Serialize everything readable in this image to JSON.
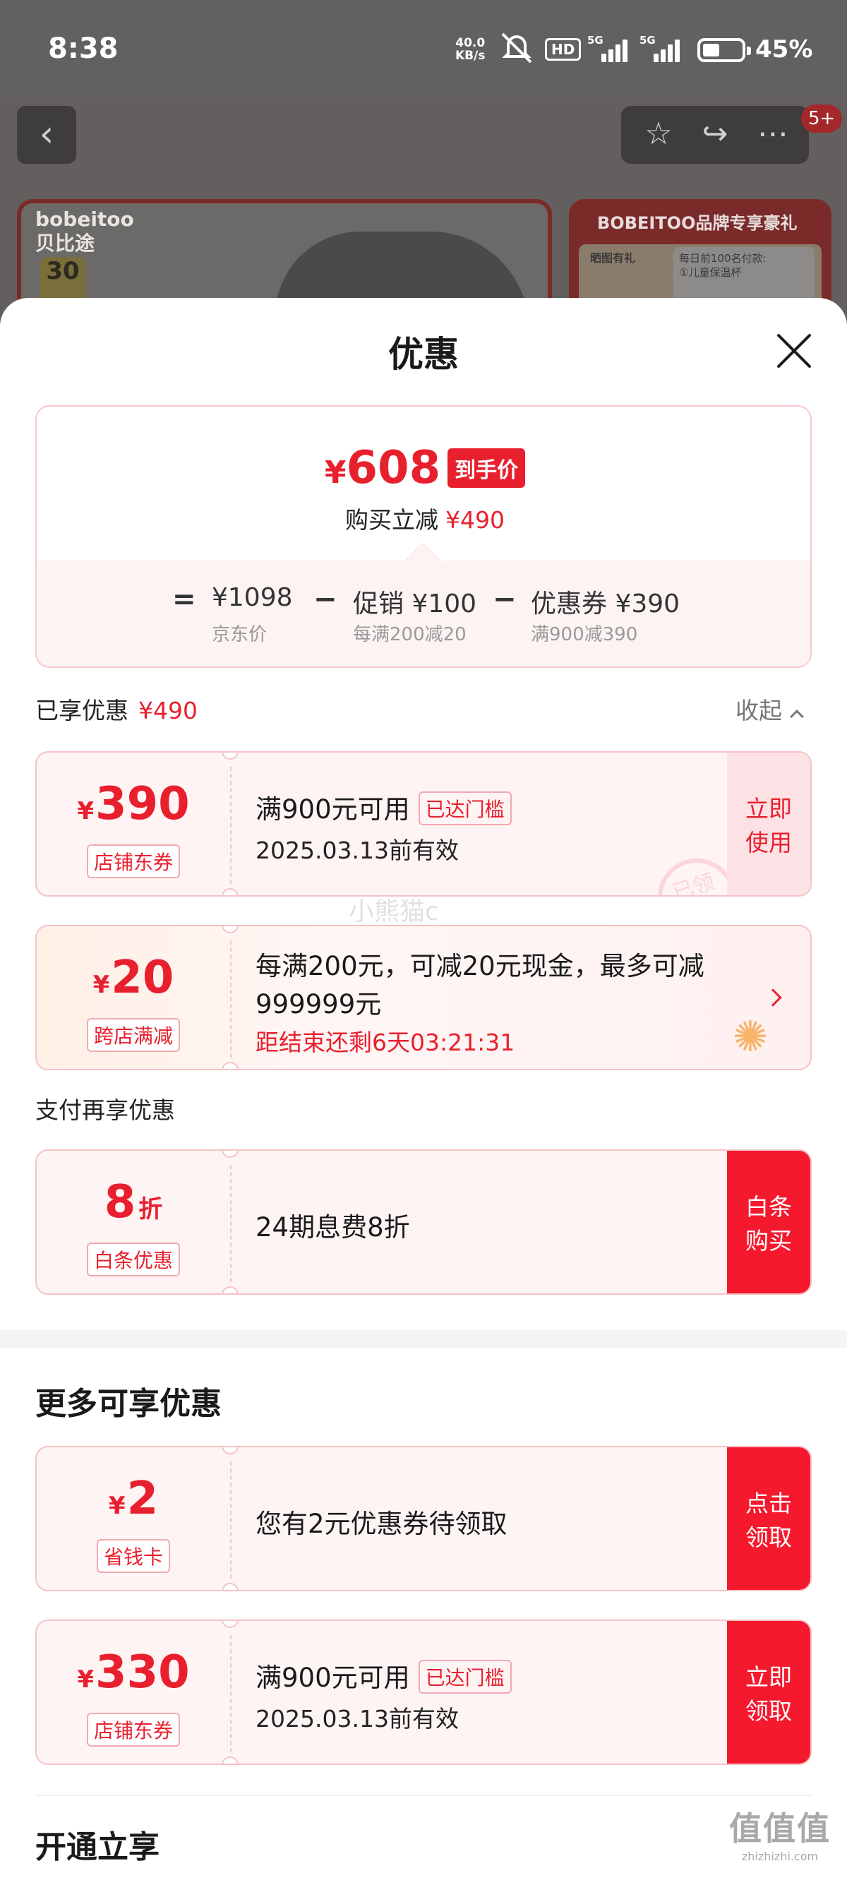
{
  "status_bar": {
    "time": "8:38",
    "net_speed_value": "40.0",
    "net_speed_unit": "KB/s",
    "hd": "HD",
    "network": "5G",
    "battery_percent": "45%",
    "battery_level": 0.45
  },
  "background": {
    "notification_badge": "5+",
    "banner_brand": "bobeitoo",
    "banner_brand_cn": "贝比途",
    "banner_tag": "30",
    "brand_banner_title": "BOBEITOO品牌专享豪礼",
    "brand_banner_tag": "晒图有礼",
    "brand_banner_line1": "每日前100名付款:",
    "brand_banner_line2": "①儿童保温杯"
  },
  "sheet": {
    "title": "优惠",
    "price_summary": {
      "currency": "¥",
      "final_price": "608",
      "final_tag": "到手价",
      "reduce_label": "购买立减",
      "reduce_amount": "¥490",
      "equals": "=",
      "minus": "−",
      "items": [
        {
          "main": "¥1098",
          "sub": "京东价"
        },
        {
          "main": "促销 ¥100",
          "sub": "每满200减20"
        },
        {
          "main": "优惠券 ¥390",
          "sub": "满900减390"
        }
      ]
    },
    "enjoyed": {
      "label": "已享优惠",
      "amount": "¥490",
      "collapse": "收起"
    },
    "coupons": [
      {
        "currency": "¥",
        "amount": "390",
        "kind": "店铺东券",
        "desc": "满900元可用",
        "condition": "已达门槛",
        "valid": "2025.03.13前有效",
        "cta_line1": "立即",
        "cta_line2": "使用",
        "stamp": "已领"
      },
      {
        "currency": "¥",
        "amount": "20",
        "kind": "跨店满减",
        "desc_line1": "每满200元，可减20元现金，最多可减",
        "desc_line2": "999999元",
        "countdown": "距结束还剩6天03:21:31"
      }
    ],
    "pay_section": {
      "label": "支付再享优惠",
      "amount": "8",
      "unit": "折",
      "kind": "白条优惠",
      "desc": "24期息费8折",
      "cta_line1": "白条",
      "cta_line2": "购买"
    },
    "more": {
      "title": "更多可享优惠",
      "items": [
        {
          "currency": "¥",
          "amount": "2",
          "kind": "省钱卡",
          "desc": "您有2元优惠券待领取",
          "cta_line1": "点击",
          "cta_line2": "领取"
        },
        {
          "currency": "¥",
          "amount": "330",
          "kind": "店铺东券",
          "desc": "满900元可用",
          "condition": "已达门槛",
          "valid": "2025.03.13前有效",
          "cta_line1": "立即",
          "cta_line2": "领取"
        }
      ]
    },
    "open_section": {
      "title": "开通立享"
    },
    "watermark": "小熊猫c",
    "corner_watermark": "值值值",
    "corner_watermark_url": "zhizhizhi.com"
  },
  "colors": {
    "accent": "#e8202e",
    "cta_red": "#f5192d",
    "coupon_bg": "#fff4f4"
  }
}
